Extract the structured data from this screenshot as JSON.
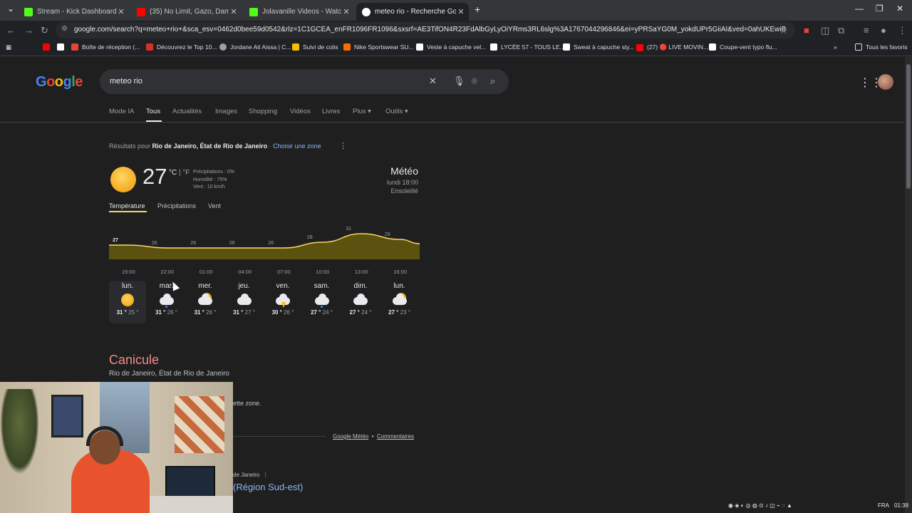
{
  "browser": {
    "tabs": [
      {
        "title": "Stream - Kick Dashboard",
        "color": "#53fc18"
      },
      {
        "title": "(35) No Limit, Gazo, Damso - Li",
        "color": "#ff0000"
      },
      {
        "title": "Jolavanille Videos - Watch On-",
        "color": "#53fc18"
      },
      {
        "title": "meteo rio - Recherche Google",
        "color": "#ffffff"
      }
    ],
    "new_tab": "+",
    "url": "google.com/search?q=meteo+rio+&sca_esv=0462d0bee59d0542&rlz=1C1GCEA_enFR1096FR1096&sxsrf=AE3TifON4R23FdAlbGyLyOiYRms3RL6slg%3A1767044296846&ei=yPRSaYG0M_yokdUPr5GiiAI&ved=0ahUKEwiBuPb4OORAxV8V...",
    "bookmarks": [
      {
        "label": "Boîte de réception (...",
        "color": "#ea4335"
      },
      {
        "label": "Découvrez le Top 10...",
        "color": "#d93025"
      },
      {
        "label": "Jordane Ait Aissa | C...",
        "color": "#a0a0a0"
      },
      {
        "label": "Suivi de colis",
        "color": "#fbbc04"
      },
      {
        "label": "Nike Sportswear SU...",
        "color": "#ff6d01"
      },
      {
        "label": "Veste à capuche vel...",
        "color": "#ffffff"
      },
      {
        "label": "LYCÉE 57 - TOUS LE...",
        "color": "#ffffff"
      },
      {
        "label": "Sweat à capuche sty...",
        "color": "#ffffff"
      },
      {
        "label": "(27) 🔴 LIVE MOVIN...",
        "color": "#ff0000"
      },
      {
        "label": "Coupe-vent typo flu...",
        "color": "#ffffff"
      }
    ],
    "all_favorites": "Tous les favoris"
  },
  "google": {
    "logo": "Google",
    "query": "meteo rio",
    "search_tabs": [
      "Mode IA",
      "Tous",
      "Actualités",
      "Images",
      "Shopping",
      "Vidéos",
      "Livres",
      "Plus ▾",
      "Outils ▾"
    ],
    "active_tab": "Tous",
    "results_for_prefix": "Résultats pour ",
    "results_for_place": "Rio de Janeiro, État de Rio de Janeiro",
    "choose_zone": "Choisir une zone"
  },
  "weather": {
    "temp": "27",
    "unit_c": "°C",
    "unit_sep": " | ",
    "unit_f": "°F",
    "precip": "Précipitations : 0%",
    "humidity": "Humidité : 75%",
    "wind": "Vent : 10 km/h",
    "title": "Météo",
    "time": "lundi 18:00",
    "condition": "Ensoleillé",
    "tabs": [
      "Température",
      "Précipitations",
      "Vent"
    ],
    "days": [
      {
        "name": "lun.",
        "icon": "sun-icon",
        "high": "31 °",
        "low": "25 °"
      },
      {
        "name": "mar.",
        "icon": "cloud-rain-icon",
        "high": "31 °",
        "low": "26 °"
      },
      {
        "name": "mer.",
        "icon": "partly-cloudy-icon",
        "high": "31 °",
        "low": "26 °"
      },
      {
        "name": "jeu.",
        "icon": "cloud-icon",
        "high": "31 °",
        "low": "27 °"
      },
      {
        "name": "ven.",
        "icon": "thunderstorm-icon",
        "high": "30 °",
        "low": "26 °"
      },
      {
        "name": "sam.",
        "icon": "cloud-rain-icon",
        "high": "27 °",
        "low": "24 °"
      },
      {
        "name": "dim.",
        "icon": "cloud-icon",
        "high": "27 °",
        "low": "24 °"
      },
      {
        "name": "lun.",
        "icon": "partly-cloudy-icon",
        "high": "27 °",
        "low": "23 °"
      }
    ]
  },
  "chart_data": {
    "type": "area",
    "x": [
      "19:00",
      "22:00",
      "01:00",
      "04:00",
      "07:00",
      "10:00",
      "13:00",
      "16:00"
    ],
    "values": [
      27,
      26,
      26,
      26,
      26,
      28,
      31,
      29
    ],
    "ylim": [
      22,
      33
    ],
    "fill_color": "#5b5210",
    "line_color": "#fdd663"
  },
  "canicule": {
    "title": "Canicule",
    "subtitle": "Rio de Janeiro, État de Rio de Janeiro",
    "partial_text": "ette zone."
  },
  "footer": {
    "source": "Google Météo",
    "dot": "•",
    "feedback": "Commentaires"
  },
  "next_result": {
    "source_partial": "de Janeiro",
    "title_partial": "(Région Sud-est)"
  },
  "taskbar": {
    "lang": "FRA",
    "time": "01:38"
  }
}
